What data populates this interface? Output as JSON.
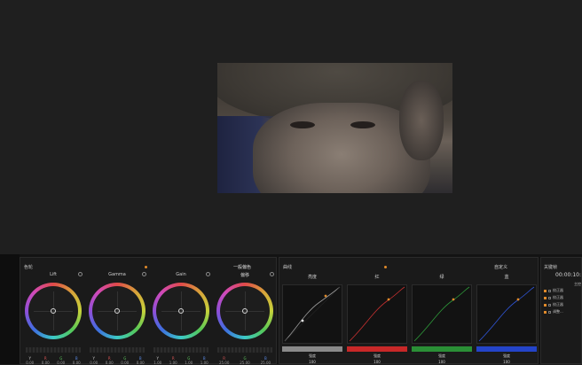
{
  "wheels_section": {
    "title": "色轮",
    "mode": "一般偏色",
    "wheels": [
      {
        "name": "Lift",
        "labels": [
          "Y",
          "R",
          "G",
          "B"
        ],
        "values": [
          "0.00",
          "0.00",
          "0.00",
          "0.00"
        ]
      },
      {
        "name": "Gamma",
        "labels": [
          "Y",
          "R",
          "G",
          "B"
        ],
        "values": [
          "0.00",
          "0.00",
          "0.00",
          "0.00"
        ]
      },
      {
        "name": "Gain",
        "labels": [
          "Y",
          "R",
          "G",
          "B"
        ],
        "values": [
          "1.00",
          "1.00",
          "1.00",
          "1.00"
        ]
      },
      {
        "name": "偏移",
        "labels": [
          "Y",
          "R",
          "G",
          "B"
        ],
        "values": [
          "25.00",
          "25.00",
          "25.00"
        ]
      }
    ]
  },
  "curves_section": {
    "title": "曲线",
    "mode": "自定义",
    "curves": [
      {
        "name": "亮度",
        "color": "#9a9a9a",
        "label": "强度",
        "value": "100"
      },
      {
        "name": "红",
        "color": "#d03030",
        "label": "强度",
        "value": "100"
      },
      {
        "name": "绿",
        "color": "#2e9a3a",
        "label": "强度",
        "value": "100"
      },
      {
        "name": "蓝",
        "color": "#2f55d8",
        "label": "强度",
        "value": "100"
      }
    ]
  },
  "keyframes_section": {
    "title": "关键帧",
    "timecode": "00:00:10:",
    "main_label": "主控",
    "rows": [
      "校正器",
      "校正器",
      "校正器",
      "调整..."
    ]
  }
}
